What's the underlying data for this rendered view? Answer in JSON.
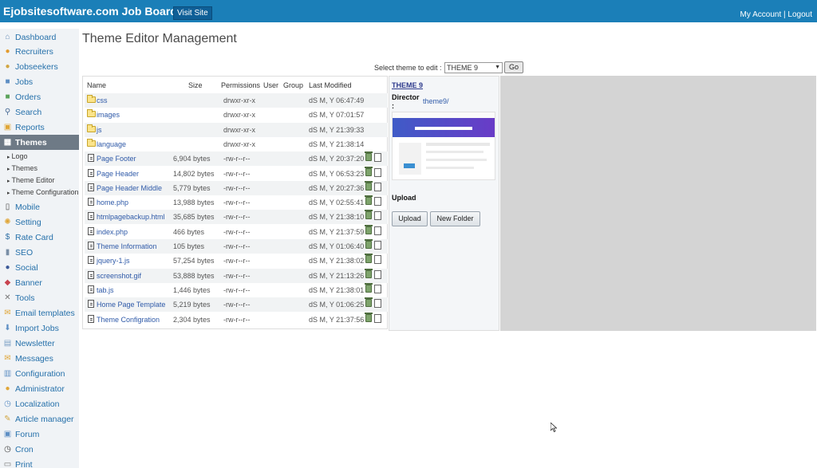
{
  "header": {
    "brand": "Ejobsitesoftware.com Job Board",
    "visit_site": "Visit Site",
    "my_account": "My Account",
    "separator": "|",
    "logout": "Logout"
  },
  "sidebar": {
    "items": [
      {
        "label": "Dashboard",
        "icon": "home-icon",
        "color": "#6a8fb8"
      },
      {
        "label": "Recruiters",
        "icon": "user-icon",
        "color": "#e39b2d"
      },
      {
        "label": "Jobseekers",
        "icon": "users-icon",
        "color": "#d1a642"
      },
      {
        "label": "Jobs",
        "icon": "briefcase-icon",
        "color": "#5e8fc4"
      },
      {
        "label": "Orders",
        "icon": "orders-icon",
        "color": "#5ba35b"
      },
      {
        "label": "Search",
        "icon": "search-icon",
        "color": "#4a6c96"
      },
      {
        "label": "Reports",
        "icon": "book-icon",
        "color": "#e0a637"
      },
      {
        "label": "Themes",
        "icon": "themes-icon",
        "color": "#ffffff"
      },
      {
        "label": "Mobile",
        "icon": "mobile-icon",
        "color": "#444444"
      },
      {
        "label": "Setting",
        "icon": "gear-icon",
        "color": "#e0a637"
      },
      {
        "label": "Rate Card",
        "icon": "dollar-icon",
        "color": "#2f6fa5"
      },
      {
        "label": "SEO",
        "icon": "seo-icon",
        "color": "#7a8fa6"
      },
      {
        "label": "Social",
        "icon": "social-icon",
        "color": "#3b5998"
      },
      {
        "label": "Banner",
        "icon": "banner-icon",
        "color": "#c8434f"
      },
      {
        "label": "Tools",
        "icon": "tools-icon",
        "color": "#777777"
      },
      {
        "label": "Email templates",
        "icon": "email-icon",
        "color": "#e0a637"
      },
      {
        "label": "Import Jobs",
        "icon": "import-icon",
        "color": "#5e8fc4"
      },
      {
        "label": "Newsletter",
        "icon": "newsletter-icon",
        "color": "#7a9fc4"
      },
      {
        "label": "Messages",
        "icon": "messages-icon",
        "color": "#e0a637"
      },
      {
        "label": "Configuration",
        "icon": "config-icon",
        "color": "#5e8fc4"
      },
      {
        "label": "Administrator",
        "icon": "admin-icon",
        "color": "#e0a637"
      },
      {
        "label": "Localization",
        "icon": "clock-icon",
        "color": "#5e8fc4"
      },
      {
        "label": "Article manager",
        "icon": "pencil-icon",
        "color": "#d1a642"
      },
      {
        "label": "Forum",
        "icon": "forum-icon",
        "color": "#5e8fc4"
      },
      {
        "label": "Cron",
        "icon": "clock-icon",
        "color": "#444444"
      },
      {
        "label": "Print",
        "icon": "print-icon",
        "color": "#777777"
      }
    ],
    "subitems": [
      "Logo",
      "Themes",
      "Theme Editor",
      "Theme Configuration"
    ]
  },
  "main": {
    "title": "Theme Editor Management",
    "select_label": "Select theme to edit :",
    "select_value": "THEME 9",
    "go": "Go"
  },
  "table": {
    "headers": {
      "name": "Name",
      "size": "Size",
      "permissions": "Permissions",
      "user": "User",
      "group": "Group",
      "modified": "Last Modified"
    },
    "rows": [
      {
        "type": "folder",
        "name": "css",
        "size": "",
        "perm": "drwxr-xr-x",
        "date": "dS M, Y 06:47:49"
      },
      {
        "type": "folder",
        "name": "images",
        "size": "",
        "perm": "drwxr-xr-x",
        "date": "dS M, Y 07:01:57"
      },
      {
        "type": "folder",
        "name": "js",
        "size": "",
        "perm": "drwxr-xr-x",
        "date": "dS M, Y 21:39:33"
      },
      {
        "type": "folder",
        "name": "language",
        "size": "",
        "perm": "drwxr-xr-x",
        "date": "dS M, Y 21:38:14"
      },
      {
        "type": "file",
        "name": "Page Footer",
        "size": "6,904 bytes",
        "perm": "-rw-r--r--",
        "date": "dS M, Y 20:37:20"
      },
      {
        "type": "file",
        "name": "Page Header",
        "size": "14,802 bytes",
        "perm": "-rw-r--r--",
        "date": "dS M, Y 06:53:23"
      },
      {
        "type": "file",
        "name": "Page Header Middle",
        "size": "5,779 bytes",
        "perm": "-rw-r--r--",
        "date": "dS M, Y 20:27:36"
      },
      {
        "type": "file",
        "name": "home.php",
        "size": "13,988 bytes",
        "perm": "-rw-r--r--",
        "date": "dS M, Y 02:55:41"
      },
      {
        "type": "file",
        "name": "htmlpagebackup.html",
        "size": "35,685 bytes",
        "perm": "-rw-r--r--",
        "date": "dS M, Y 21:38:10"
      },
      {
        "type": "file",
        "name": "index.php",
        "size": "466 bytes",
        "perm": "-rw-r--r--",
        "date": "dS M, Y 21:37:59"
      },
      {
        "type": "file",
        "name": "Theme Information",
        "size": "105 bytes",
        "perm": "-rw-r--r--",
        "date": "dS M, Y 01:06:40"
      },
      {
        "type": "file",
        "name": "jquery-1.js",
        "size": "57,254 bytes",
        "perm": "-rw-r--r--",
        "date": "dS M, Y 21:38:02"
      },
      {
        "type": "file",
        "name": "screenshot.gif",
        "size": "53,888 bytes",
        "perm": "-rw-r--r--",
        "date": "dS M, Y 21:13:26"
      },
      {
        "type": "file",
        "name": "tab.js",
        "size": "1,446 bytes",
        "perm": "-rw-r--r--",
        "date": "dS M, Y 21:38:01"
      },
      {
        "type": "file",
        "name": "Home Page Template",
        "size": "5,219 bytes",
        "perm": "-rw-r--r--",
        "date": "dS M, Y 01:06:25"
      },
      {
        "type": "file",
        "name": "Theme Configration",
        "size": "2,304 bytes",
        "perm": "-rw-r--r--",
        "date": "dS M, Y 21:37:56"
      }
    ]
  },
  "info": {
    "theme_link": "THEME 9",
    "director_label": "Director :",
    "director_value": "theme9/",
    "upload_label": "Upload",
    "upload_button": "Upload",
    "new_folder_button": "New Folder"
  }
}
